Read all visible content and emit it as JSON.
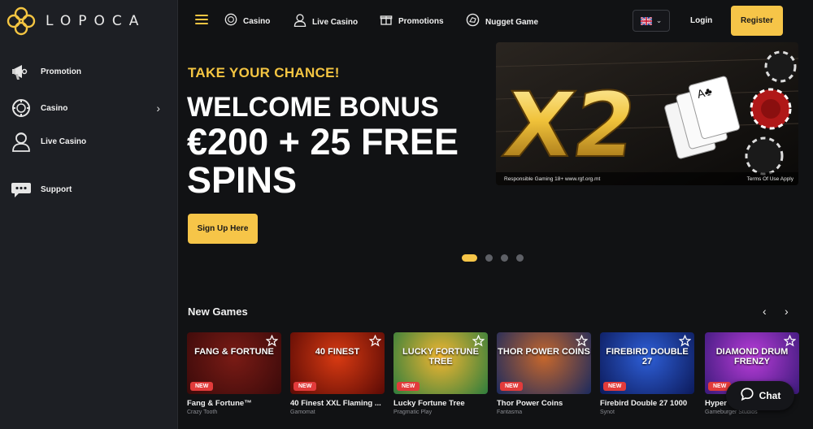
{
  "brand": {
    "name": "LOPOCA",
    "accent": "#f6c548"
  },
  "sidebar": {
    "items": [
      {
        "label": "Promotion",
        "icon": "megaphone-icon"
      },
      {
        "label": "Casino",
        "icon": "chip-icon"
      },
      {
        "label": "Live Casino",
        "icon": "dealer-icon"
      },
      {
        "label": "Support",
        "icon": "chat-bubble-icon"
      }
    ]
  },
  "topbar": {
    "nav": [
      {
        "label": "Casino",
        "icon": "chip-icon"
      },
      {
        "label": "Live Casino",
        "icon": "dealer-icon"
      },
      {
        "label": "Promotions",
        "icon": "gift-icon"
      },
      {
        "label": "Nugget Game",
        "icon": "nugget-icon"
      }
    ],
    "language": "uk-flag-icon",
    "login_label": "Login",
    "register_label": "Register"
  },
  "hero": {
    "kicker": "TAKE YOUR CHANCE!",
    "title": "WELCOME BONUS",
    "amount": "€200 + 25 FREE SPINS",
    "cta_label": "Sign Up Here",
    "banner": {
      "headline": "X2",
      "footer_left": "Responsible Gaming 18+ www.rgf.org.mt",
      "footer_right": "Terms Of Use Apply"
    },
    "slides": {
      "count": 4,
      "active": 1
    }
  },
  "new_games": {
    "title": "New Games",
    "games": [
      {
        "name": "Fang & Fortune™",
        "provider": "Crazy Tooth",
        "art": "FANG & FORTUNE",
        "badge": "NEW",
        "colors": [
          "#3a0a0a",
          "#7a1b15"
        ]
      },
      {
        "name": "40 Finest XXL Flaming ...",
        "provider": "Gamomat",
        "art": "40 FINEST",
        "badge": "NEW",
        "colors": [
          "#5a0a05",
          "#d83a12"
        ]
      },
      {
        "name": "Lucky Fortune Tree",
        "provider": "Pragmatic Play",
        "art": "LUCKY FORTUNE TREE",
        "badge": "NEW",
        "colors": [
          "#2e7d3c",
          "#f2b632"
        ]
      },
      {
        "name": "Thor Power Coins",
        "provider": "Fantasma",
        "art": "THOR POWER COINS",
        "badge": "NEW",
        "colors": [
          "#1b2a5e",
          "#c6672c"
        ]
      },
      {
        "name": "Firebird Double 27 1000",
        "provider": "Synot",
        "art": "FIREBIRD DOUBLE 27",
        "badge": "NEW",
        "colors": [
          "#0c1a5a",
          "#2e5fd8"
        ]
      },
      {
        "name": "Hyper",
        "provider": "Gameburger Studios",
        "art": "DIAMOND DRUM FRENZY",
        "badge": "NEW",
        "colors": [
          "#3a1a7a",
          "#b93cd8"
        ]
      }
    ]
  },
  "chat": {
    "label": "Chat"
  }
}
